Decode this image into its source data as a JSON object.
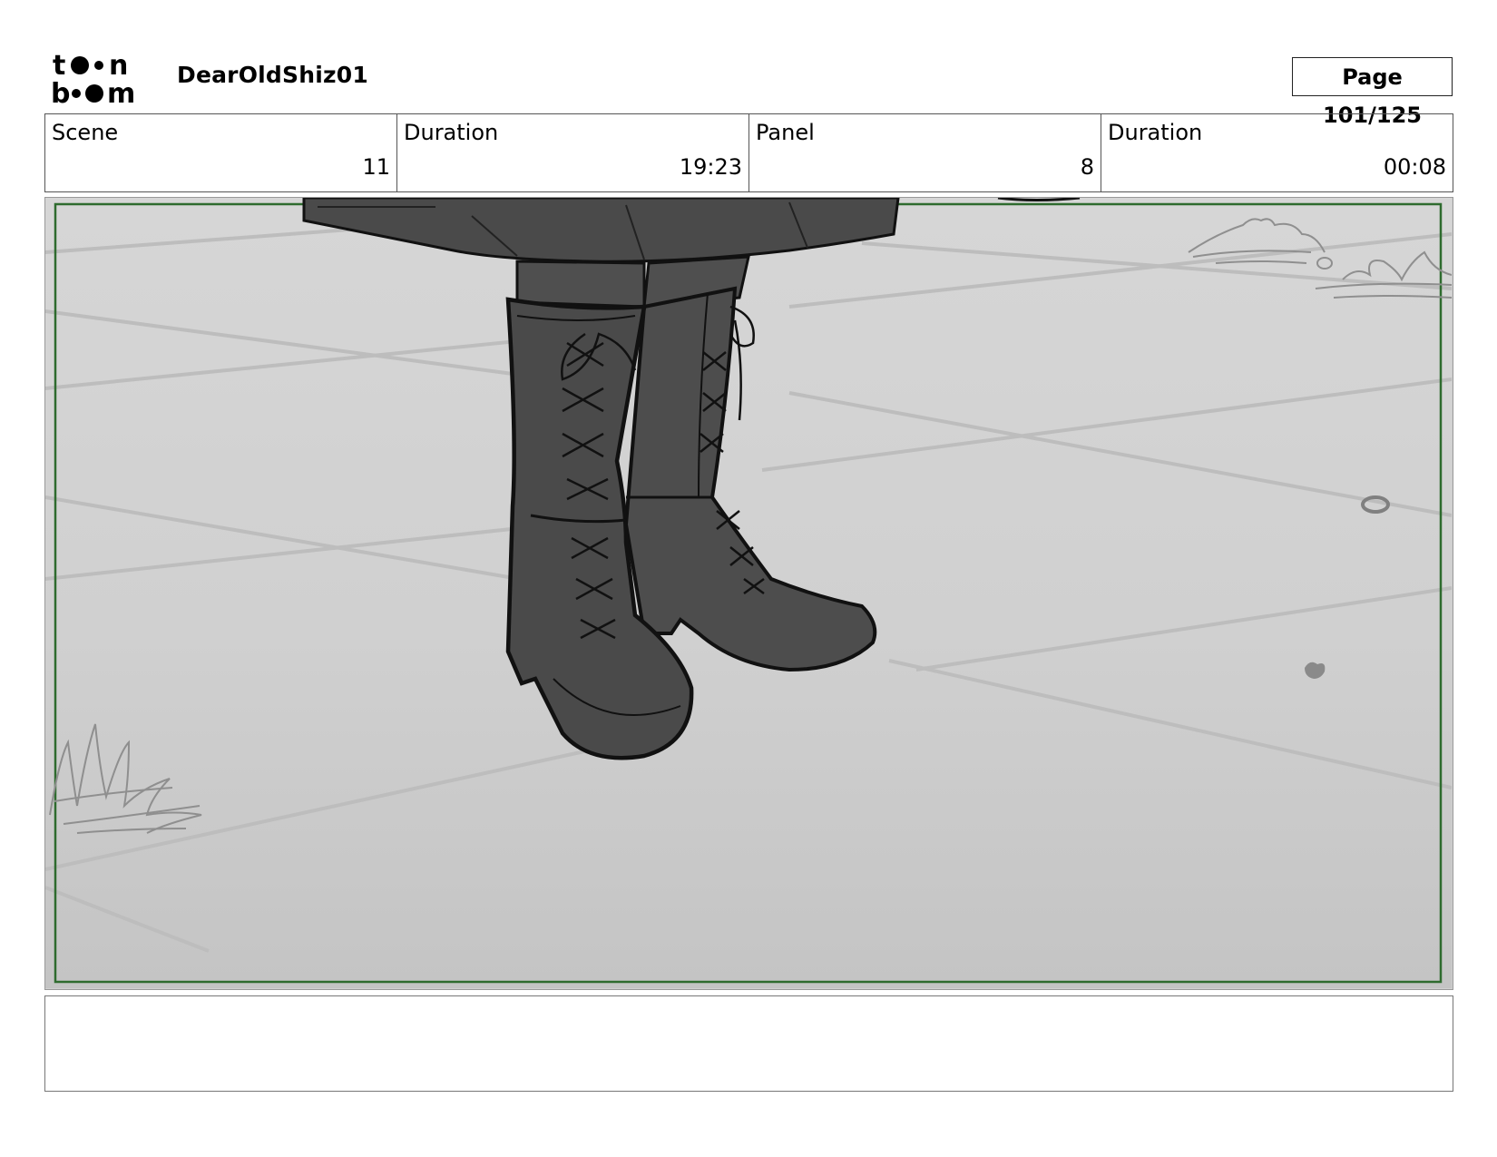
{
  "header": {
    "logo_alt": "toon boom",
    "project_title": "DearOldShiz01",
    "page_label": "Page 101/125"
  },
  "info": {
    "scene_label": "Scene",
    "scene_value": "11",
    "scene_duration_label": "Duration",
    "scene_duration_value": "19:23",
    "panel_label": "Panel",
    "panel_value": "8",
    "panel_duration_label": "Duration",
    "panel_duration_value": "00:08"
  },
  "panel": {
    "description": "",
    "safe_frame_color": "#2e6b2e"
  },
  "notes": {
    "text": ""
  }
}
